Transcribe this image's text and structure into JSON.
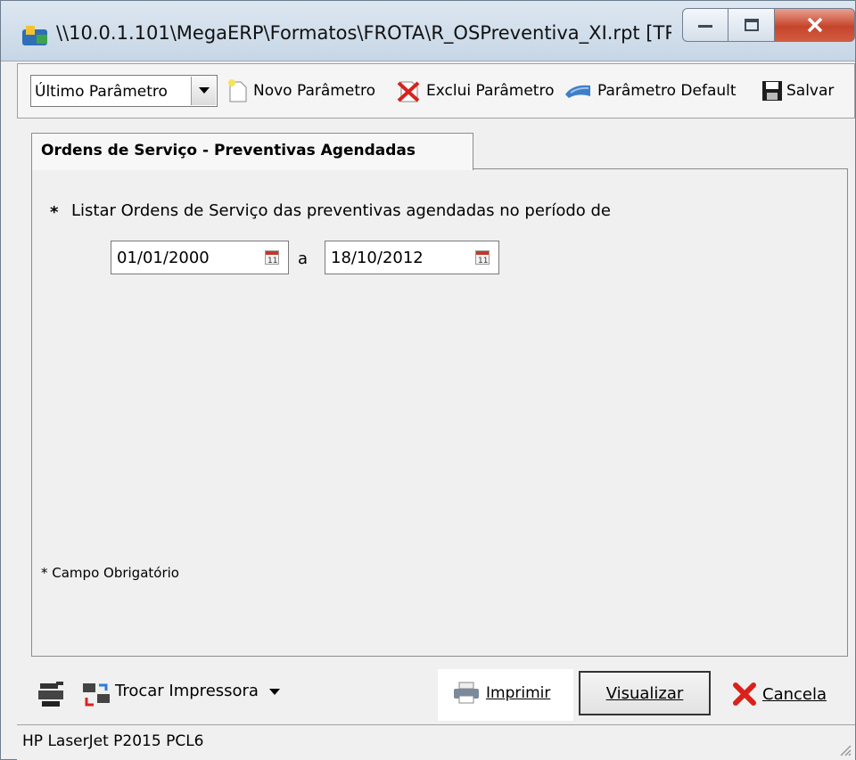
{
  "window": {
    "title": "\\\\10.0.1.101\\MegaERP\\Formatos\\FROTA\\R_OSPreventiva_XI.rpt [TR..."
  },
  "toolbar": {
    "parameter_combo_value": "Último Parâmetro",
    "novo_label": "Novo Parâmetro",
    "exclui_label": "Exclui Parâmetro",
    "default_label": "Parâmetro Default",
    "salvar_label": "Salvar"
  },
  "tab": {
    "label": "Ordens de Serviço - Preventivas Agendadas"
  },
  "form": {
    "required_marker": "*",
    "period_label": "Listar Ordens de Serviço das preventivas agendadas no período de",
    "date_from": "01/01/2000",
    "date_separator": "a",
    "date_to": "18/10/2012",
    "required_note": "* Campo Obrigatório"
  },
  "footer": {
    "trocar_label": "Trocar Impressora",
    "imprimir_label": "Imprimir",
    "visualizar_label": "Visualizar",
    "cancela_label": "Cancela"
  },
  "status": {
    "printer": "HP LaserJet P2015 PCL6"
  },
  "colors": {
    "close_button": "#c6452c",
    "window_background": "#f0f0f0"
  }
}
